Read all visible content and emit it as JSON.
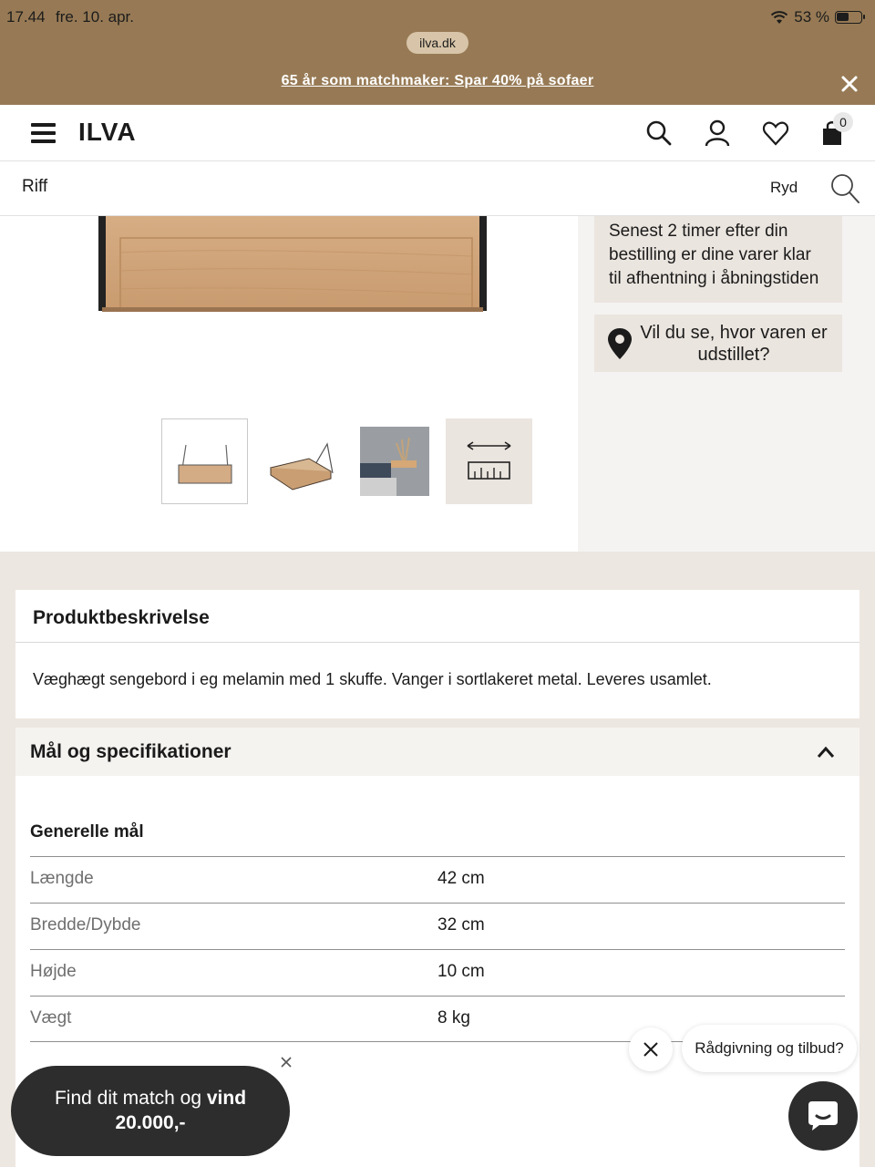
{
  "status": {
    "time": "17.44",
    "date": "fre. 10. apr.",
    "battery": "53 %"
  },
  "browser": {
    "url": "ilva.dk"
  },
  "promo": {
    "text": "65 år som matchmaker: Spar 40% på sofaer"
  },
  "header": {
    "logo": "ILVA",
    "cart_count": "0"
  },
  "search": {
    "value": "Riff",
    "clear_label": "Ryd"
  },
  "side": {
    "pickup_text": "Senest 2 timer efter din bestilling er dine varer klar til afhentning i åbningstiden",
    "showroom_text": "Vil du se, hvor varen er udstillet?"
  },
  "description": {
    "title": "Produktbeskrivelse",
    "text": "Væghægt sengebord i eg melamin med 1 skuffe. Vanger i sortlakeret metal. Leveres usamlet."
  },
  "specs": {
    "title": "Mål og specifikationer",
    "group": "Generelle mål",
    "rows": [
      {
        "label": "Længde",
        "value": "42 cm"
      },
      {
        "label": "Bredde/Dybde",
        "value": "32 cm"
      },
      {
        "label": "Højde",
        "value": "10 cm"
      },
      {
        "label": "Vægt",
        "value": "8 kg"
      }
    ]
  },
  "widgets": {
    "match_line1": "Find dit match og ",
    "match_bold1": "vind",
    "match_line2": "20.000,-",
    "chat_prompt": "Rådgivning og tilbud?"
  },
  "colors": {
    "promo_bg": "#977a55",
    "page_bg": "#ede7e1",
    "dark": "#2d2d2d"
  }
}
